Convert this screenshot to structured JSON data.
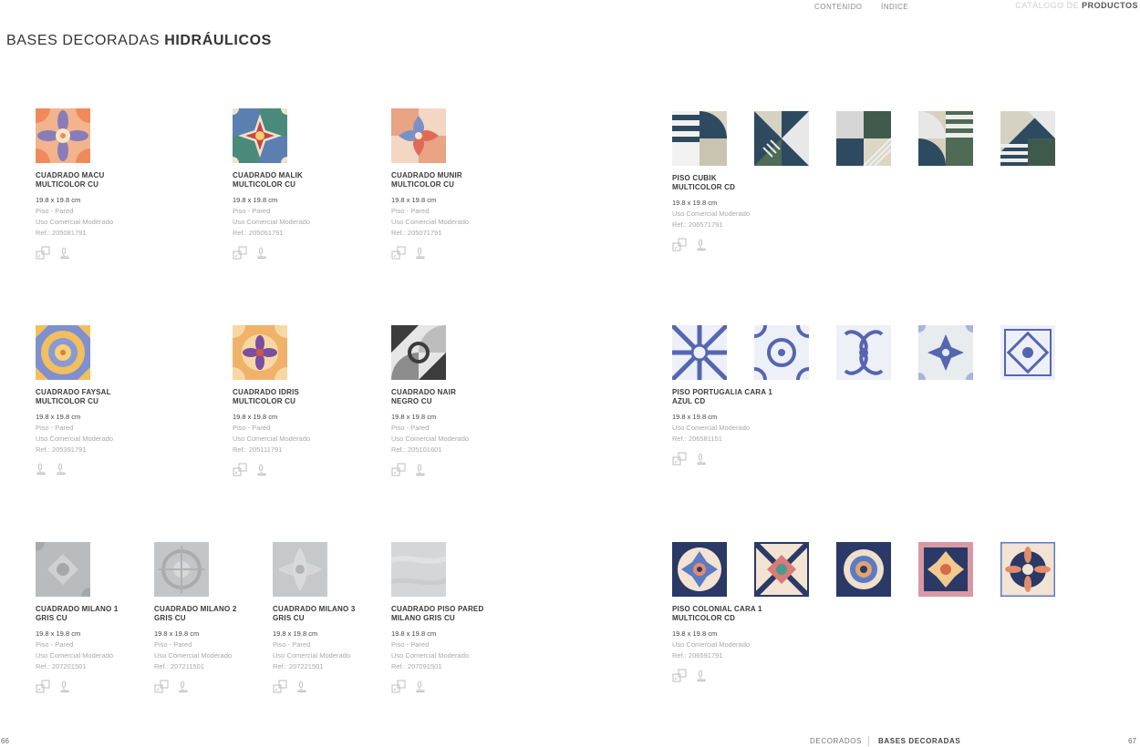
{
  "header": {
    "nav": [
      "CONTENIDO",
      "ÍNDICE"
    ],
    "catalog_light": "CATÁLOGO DE",
    "catalog_bold": "PRODUCTOS"
  },
  "page_title": {
    "light": "BASES DECORADAS",
    "bold": "HIDRÁULICOS"
  },
  "products": [
    {
      "name1": "CUADRADO MACU",
      "name2": "MULTICOLOR CU",
      "size": "19.8 x 19.8 cm",
      "use": "Piso - Pared",
      "traffic": "Uso Comercial Moderado",
      "ref": "Ref.: 205081791"
    },
    {
      "name1": "CUADRADO MALIK",
      "name2": "MULTICOLOR CU",
      "size": "19.8 x 19.8 cm",
      "use": "Piso - Pared",
      "traffic": "Uso Comercial Moderado",
      "ref": "Ref.: 205061791"
    },
    {
      "name1": "CUADRADO MUNIR",
      "name2": "MULTICOLOR CU",
      "size": "19.8 x 19.8 cm",
      "use": "Piso - Pared",
      "traffic": "Uso Comercial Moderado",
      "ref": "Ref.: 205071791"
    },
    {
      "name1": "PISO CUBIK",
      "name2": "MULTICOLOR CD",
      "size": "19.8 x 19.8 cm",
      "use": "Uso Comercial Moderado",
      "traffic": "",
      "ref": "Ref.: 206571791"
    },
    {
      "name1": "CUADRADO FAYSAL",
      "name2": "MULTICOLOR CU",
      "size": "19.8 x 19.8 cm",
      "use": "Piso - Pared",
      "traffic": "Uso Comercial Moderado",
      "ref": "Ref.: 205391791"
    },
    {
      "name1": "CUADRADO IDRIS",
      "name2": "MULTICOLOR CU",
      "size": "19.8 x 19.8 cm",
      "use": "Piso - Pared",
      "traffic": "Uso Comercial Moderado",
      "ref": "Ref.: 205111791"
    },
    {
      "name1": "CUADRADO NAIR",
      "name2": "NEGRO CU",
      "size": "19.8 x 19.8 cm",
      "use": "Piso - Pared",
      "traffic": "Uso Comercial Moderado",
      "ref": "Ref.: 205101601"
    },
    {
      "name1": "PISO PORTUGALIA CARA 1",
      "name2": "AZUL CD",
      "size": "19.8 x 19.8 cm",
      "use": "Uso Comercial Moderado",
      "traffic": "",
      "ref": "Ref.: 206581151"
    },
    {
      "name1": "CUADRADO MILANO 1",
      "name2": "GRIS CU",
      "size": "19.8 x 19.8 cm",
      "use": "Piso - Pared",
      "traffic": "Uso Comercial Moderado",
      "ref": "Ref.: 207201501"
    },
    {
      "name1": "CUADRADO MILANO 2",
      "name2": "GRIS CU",
      "size": "19.8 x 19.8 cm",
      "use": "Piso - Pared",
      "traffic": "Uso Comercial Moderado",
      "ref": "Ref.: 207211501"
    },
    {
      "name1": "CUADRADO MILANO 3",
      "name2": "GRIS CU",
      "size": "19.8 x 19.8 cm",
      "use": "Piso - Pared",
      "traffic": "Uso Comercial Moderado",
      "ref": "Ref.: 207221501"
    },
    {
      "name1": "CUADRADO PISO PARED",
      "name2": "MILANO GRIS CU",
      "size": "19.8 x 19.8 cm",
      "use": "Piso - Pared",
      "traffic": "Uso Comercial Moderado",
      "ref": "Ref.: 207091501"
    },
    {
      "name1": "PISO COLONIAL CARA 1",
      "name2": "MULTICOLOR CD",
      "size": "19.8 x 19.8 cm",
      "use": "Uso Comercial Moderado",
      "traffic": "",
      "ref": "Ref.: 206591791"
    }
  ],
  "icons": {
    "floor_wall": "floor-wall-icon",
    "traffic": "foot-traffic-icon"
  },
  "footer": {
    "page_left": "66",
    "page_right": "67",
    "section": "DECORADOS",
    "subsection": "BASES DECORADAS"
  },
  "colors": {
    "text": "#3c3c3c",
    "muted": "#a8a8a8",
    "cubik_navy": "#2e4a60",
    "portugalia_blue": "#5566b0",
    "colonial_navy": "#2a3966"
  }
}
